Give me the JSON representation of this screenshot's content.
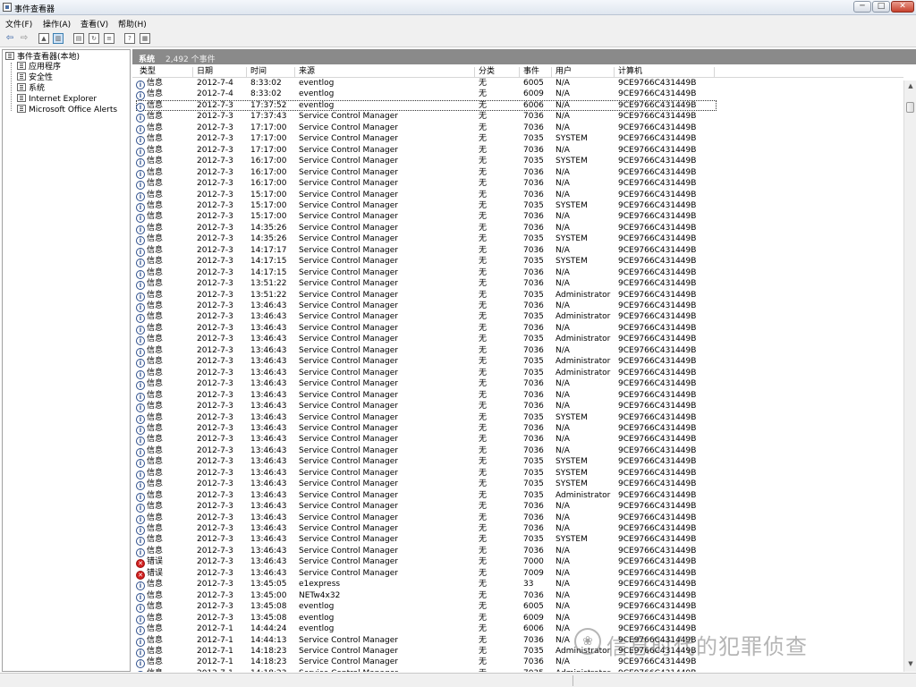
{
  "window": {
    "title": "事件查看器",
    "controls": {
      "minimize": "─",
      "maximize": "□",
      "close": "✕"
    }
  },
  "menu": [
    {
      "id": "file",
      "label": "文件(F)"
    },
    {
      "id": "action",
      "label": "操作(A)"
    },
    {
      "id": "view",
      "label": "查看(V)"
    },
    {
      "id": "help",
      "label": "帮助(H)"
    }
  ],
  "toolbar": {
    "icons": [
      "back-arrow-icon",
      "forward-arrow-icon",
      "up-folder-icon",
      "show-hide-tree-icon",
      "properties-icon",
      "refresh-icon",
      "export-list-icon",
      "help-icon",
      "console-tree-icon"
    ]
  },
  "tree": {
    "root": "事件查看器(本地)",
    "items": [
      "应用程序",
      "安全性",
      "系统",
      "Internet Explorer",
      "Microsoft Office Alerts"
    ]
  },
  "header": {
    "name": "系统",
    "count": "2,492 个事件"
  },
  "columns": {
    "type": "类型",
    "date": "日期",
    "time": "时间",
    "source": "来源",
    "category": "分类",
    "event": "事件",
    "user": "用户",
    "computer": "计算机"
  },
  "rows": [
    {
      "type": "信息",
      "kind": "info",
      "date": "2012-7-4",
      "time": "8:33:02",
      "source": "eventlog",
      "category": "无",
      "event": "6005",
      "user": "N/A",
      "computer": "9CE9766C431449B"
    },
    {
      "type": "信息",
      "kind": "info",
      "date": "2012-7-4",
      "time": "8:33:02",
      "source": "eventlog",
      "category": "无",
      "event": "6009",
      "user": "N/A",
      "computer": "9CE9766C431449B"
    },
    {
      "type": "信息",
      "kind": "info",
      "date": "2012-7-3",
      "time": "17:37:52",
      "source": "eventlog",
      "category": "无",
      "event": "6006",
      "user": "N/A",
      "computer": "9CE9766C431449B",
      "selected": true
    },
    {
      "type": "信息",
      "kind": "info",
      "date": "2012-7-3",
      "time": "17:37:43",
      "source": "Service Control Manager",
      "category": "无",
      "event": "7036",
      "user": "N/A",
      "computer": "9CE9766C431449B"
    },
    {
      "type": "信息",
      "kind": "info",
      "date": "2012-7-3",
      "time": "17:17:00",
      "source": "Service Control Manager",
      "category": "无",
      "event": "7036",
      "user": "N/A",
      "computer": "9CE9766C431449B"
    },
    {
      "type": "信息",
      "kind": "info",
      "date": "2012-7-3",
      "time": "17:17:00",
      "source": "Service Control Manager",
      "category": "无",
      "event": "7035",
      "user": "SYSTEM",
      "computer": "9CE9766C431449B"
    },
    {
      "type": "信息",
      "kind": "info",
      "date": "2012-7-3",
      "time": "17:17:00",
      "source": "Service Control Manager",
      "category": "无",
      "event": "7036",
      "user": "N/A",
      "computer": "9CE9766C431449B"
    },
    {
      "type": "信息",
      "kind": "info",
      "date": "2012-7-3",
      "time": "16:17:00",
      "source": "Service Control Manager",
      "category": "无",
      "event": "7035",
      "user": "SYSTEM",
      "computer": "9CE9766C431449B"
    },
    {
      "type": "信息",
      "kind": "info",
      "date": "2012-7-3",
      "time": "16:17:00",
      "source": "Service Control Manager",
      "category": "无",
      "event": "7036",
      "user": "N/A",
      "computer": "9CE9766C431449B"
    },
    {
      "type": "信息",
      "kind": "info",
      "date": "2012-7-3",
      "time": "16:17:00",
      "source": "Service Control Manager",
      "category": "无",
      "event": "7036",
      "user": "N/A",
      "computer": "9CE9766C431449B"
    },
    {
      "type": "信息",
      "kind": "info",
      "date": "2012-7-3",
      "time": "15:17:00",
      "source": "Service Control Manager",
      "category": "无",
      "event": "7036",
      "user": "N/A",
      "computer": "9CE9766C431449B"
    },
    {
      "type": "信息",
      "kind": "info",
      "date": "2012-7-3",
      "time": "15:17:00",
      "source": "Service Control Manager",
      "category": "无",
      "event": "7035",
      "user": "SYSTEM",
      "computer": "9CE9766C431449B"
    },
    {
      "type": "信息",
      "kind": "info",
      "date": "2012-7-3",
      "time": "15:17:00",
      "source": "Service Control Manager",
      "category": "无",
      "event": "7036",
      "user": "N/A",
      "computer": "9CE9766C431449B"
    },
    {
      "type": "信息",
      "kind": "info",
      "date": "2012-7-3",
      "time": "14:35:26",
      "source": "Service Control Manager",
      "category": "无",
      "event": "7036",
      "user": "N/A",
      "computer": "9CE9766C431449B"
    },
    {
      "type": "信息",
      "kind": "info",
      "date": "2012-7-3",
      "time": "14:35:26",
      "source": "Service Control Manager",
      "category": "无",
      "event": "7035",
      "user": "SYSTEM",
      "computer": "9CE9766C431449B"
    },
    {
      "type": "信息",
      "kind": "info",
      "date": "2012-7-3",
      "time": "14:17:17",
      "source": "Service Control Manager",
      "category": "无",
      "event": "7036",
      "user": "N/A",
      "computer": "9CE9766C431449B"
    },
    {
      "type": "信息",
      "kind": "info",
      "date": "2012-7-3",
      "time": "14:17:15",
      "source": "Service Control Manager",
      "category": "无",
      "event": "7035",
      "user": "SYSTEM",
      "computer": "9CE9766C431449B"
    },
    {
      "type": "信息",
      "kind": "info",
      "date": "2012-7-3",
      "time": "14:17:15",
      "source": "Service Control Manager",
      "category": "无",
      "event": "7036",
      "user": "N/A",
      "computer": "9CE9766C431449B"
    },
    {
      "type": "信息",
      "kind": "info",
      "date": "2012-7-3",
      "time": "13:51:22",
      "source": "Service Control Manager",
      "category": "无",
      "event": "7036",
      "user": "N/A",
      "computer": "9CE9766C431449B"
    },
    {
      "type": "信息",
      "kind": "info",
      "date": "2012-7-3",
      "time": "13:51:22",
      "source": "Service Control Manager",
      "category": "无",
      "event": "7035",
      "user": "Administrator",
      "computer": "9CE9766C431449B"
    },
    {
      "type": "信息",
      "kind": "info",
      "date": "2012-7-3",
      "time": "13:46:43",
      "source": "Service Control Manager",
      "category": "无",
      "event": "7036",
      "user": "N/A",
      "computer": "9CE9766C431449B"
    },
    {
      "type": "信息",
      "kind": "info",
      "date": "2012-7-3",
      "time": "13:46:43",
      "source": "Service Control Manager",
      "category": "无",
      "event": "7035",
      "user": "Administrator",
      "computer": "9CE9766C431449B"
    },
    {
      "type": "信息",
      "kind": "info",
      "date": "2012-7-3",
      "time": "13:46:43",
      "source": "Service Control Manager",
      "category": "无",
      "event": "7036",
      "user": "N/A",
      "computer": "9CE9766C431449B"
    },
    {
      "type": "信息",
      "kind": "info",
      "date": "2012-7-3",
      "time": "13:46:43",
      "source": "Service Control Manager",
      "category": "无",
      "event": "7035",
      "user": "Administrator",
      "computer": "9CE9766C431449B"
    },
    {
      "type": "信息",
      "kind": "info",
      "date": "2012-7-3",
      "time": "13:46:43",
      "source": "Service Control Manager",
      "category": "无",
      "event": "7036",
      "user": "N/A",
      "computer": "9CE9766C431449B"
    },
    {
      "type": "信息",
      "kind": "info",
      "date": "2012-7-3",
      "time": "13:46:43",
      "source": "Service Control Manager",
      "category": "无",
      "event": "7035",
      "user": "Administrator",
      "computer": "9CE9766C431449B"
    },
    {
      "type": "信息",
      "kind": "info",
      "date": "2012-7-3",
      "time": "13:46:43",
      "source": "Service Control Manager",
      "category": "无",
      "event": "7035",
      "user": "Administrator",
      "computer": "9CE9766C431449B"
    },
    {
      "type": "信息",
      "kind": "info",
      "date": "2012-7-3",
      "time": "13:46:43",
      "source": "Service Control Manager",
      "category": "无",
      "event": "7036",
      "user": "N/A",
      "computer": "9CE9766C431449B"
    },
    {
      "type": "信息",
      "kind": "info",
      "date": "2012-7-3",
      "time": "13:46:43",
      "source": "Service Control Manager",
      "category": "无",
      "event": "7036",
      "user": "N/A",
      "computer": "9CE9766C431449B"
    },
    {
      "type": "信息",
      "kind": "info",
      "date": "2012-7-3",
      "time": "13:46:43",
      "source": "Service Control Manager",
      "category": "无",
      "event": "7036",
      "user": "N/A",
      "computer": "9CE9766C431449B"
    },
    {
      "type": "信息",
      "kind": "info",
      "date": "2012-7-3",
      "time": "13:46:43",
      "source": "Service Control Manager",
      "category": "无",
      "event": "7035",
      "user": "SYSTEM",
      "computer": "9CE9766C431449B"
    },
    {
      "type": "信息",
      "kind": "info",
      "date": "2012-7-3",
      "time": "13:46:43",
      "source": "Service Control Manager",
      "category": "无",
      "event": "7036",
      "user": "N/A",
      "computer": "9CE9766C431449B"
    },
    {
      "type": "信息",
      "kind": "info",
      "date": "2012-7-3",
      "time": "13:46:43",
      "source": "Service Control Manager",
      "category": "无",
      "event": "7036",
      "user": "N/A",
      "computer": "9CE9766C431449B"
    },
    {
      "type": "信息",
      "kind": "info",
      "date": "2012-7-3",
      "time": "13:46:43",
      "source": "Service Control Manager",
      "category": "无",
      "event": "7036",
      "user": "N/A",
      "computer": "9CE9766C431449B"
    },
    {
      "type": "信息",
      "kind": "info",
      "date": "2012-7-3",
      "time": "13:46:43",
      "source": "Service Control Manager",
      "category": "无",
      "event": "7035",
      "user": "SYSTEM",
      "computer": "9CE9766C431449B"
    },
    {
      "type": "信息",
      "kind": "info",
      "date": "2012-7-3",
      "time": "13:46:43",
      "source": "Service Control Manager",
      "category": "无",
      "event": "7035",
      "user": "SYSTEM",
      "computer": "9CE9766C431449B"
    },
    {
      "type": "信息",
      "kind": "info",
      "date": "2012-7-3",
      "time": "13:46:43",
      "source": "Service Control Manager",
      "category": "无",
      "event": "7035",
      "user": "SYSTEM",
      "computer": "9CE9766C431449B"
    },
    {
      "type": "信息",
      "kind": "info",
      "date": "2012-7-3",
      "time": "13:46:43",
      "source": "Service Control Manager",
      "category": "无",
      "event": "7035",
      "user": "Administrator",
      "computer": "9CE9766C431449B"
    },
    {
      "type": "信息",
      "kind": "info",
      "date": "2012-7-3",
      "time": "13:46:43",
      "source": "Service Control Manager",
      "category": "无",
      "event": "7036",
      "user": "N/A",
      "computer": "9CE9766C431449B"
    },
    {
      "type": "信息",
      "kind": "info",
      "date": "2012-7-3",
      "time": "13:46:43",
      "source": "Service Control Manager",
      "category": "无",
      "event": "7036",
      "user": "N/A",
      "computer": "9CE9766C431449B"
    },
    {
      "type": "信息",
      "kind": "info",
      "date": "2012-7-3",
      "time": "13:46:43",
      "source": "Service Control Manager",
      "category": "无",
      "event": "7036",
      "user": "N/A",
      "computer": "9CE9766C431449B"
    },
    {
      "type": "信息",
      "kind": "info",
      "date": "2012-7-3",
      "time": "13:46:43",
      "source": "Service Control Manager",
      "category": "无",
      "event": "7035",
      "user": "SYSTEM",
      "computer": "9CE9766C431449B"
    },
    {
      "type": "信息",
      "kind": "info",
      "date": "2012-7-3",
      "time": "13:46:43",
      "source": "Service Control Manager",
      "category": "无",
      "event": "7036",
      "user": "N/A",
      "computer": "9CE9766C431449B"
    },
    {
      "type": "错误",
      "kind": "error",
      "date": "2012-7-3",
      "time": "13:46:43",
      "source": "Service Control Manager",
      "category": "无",
      "event": "7000",
      "user": "N/A",
      "computer": "9CE9766C431449B"
    },
    {
      "type": "错误",
      "kind": "error",
      "date": "2012-7-3",
      "time": "13:46:43",
      "source": "Service Control Manager",
      "category": "无",
      "event": "7009",
      "user": "N/A",
      "computer": "9CE9766C431449B"
    },
    {
      "type": "信息",
      "kind": "info",
      "date": "2012-7-3",
      "time": "13:45:05",
      "source": "e1express",
      "category": "无",
      "event": "33",
      "user": "N/A",
      "computer": "9CE9766C431449B"
    },
    {
      "type": "信息",
      "kind": "info",
      "date": "2012-7-3",
      "time": "13:45:00",
      "source": "NETw4x32",
      "category": "无",
      "event": "7036",
      "user": "N/A",
      "computer": "9CE9766C431449B"
    },
    {
      "type": "信息",
      "kind": "info",
      "date": "2012-7-3",
      "time": "13:45:08",
      "source": "eventlog",
      "category": "无",
      "event": "6005",
      "user": "N/A",
      "computer": "9CE9766C431449B"
    },
    {
      "type": "信息",
      "kind": "info",
      "date": "2012-7-3",
      "time": "13:45:08",
      "source": "eventlog",
      "category": "无",
      "event": "6009",
      "user": "N/A",
      "computer": "9CE9766C431449B"
    },
    {
      "type": "信息",
      "kind": "info",
      "date": "2012-7-1",
      "time": "14:44:24",
      "source": "eventlog",
      "category": "无",
      "event": "6006",
      "user": "N/A",
      "computer": "9CE9766C431449B"
    },
    {
      "type": "信息",
      "kind": "info",
      "date": "2012-7-1",
      "time": "14:44:13",
      "source": "Service Control Manager",
      "category": "无",
      "event": "7036",
      "user": "N/A",
      "computer": "9CE9766C431449B"
    },
    {
      "type": "信息",
      "kind": "info",
      "date": "2012-7-1",
      "time": "14:18:23",
      "source": "Service Control Manager",
      "category": "无",
      "event": "7035",
      "user": "Administrator",
      "computer": "9CE9766C431449B"
    },
    {
      "type": "信息",
      "kind": "info",
      "date": "2012-7-1",
      "time": "14:18:23",
      "source": "Service Control Manager",
      "category": "无",
      "event": "7036",
      "user": "N/A",
      "computer": "9CE9766C431449B"
    },
    {
      "type": "信息",
      "kind": "info",
      "date": "2012-7-1",
      "time": "14:18:23",
      "source": "Service Control Manager",
      "category": "无",
      "event": "7035",
      "user": "Administrator",
      "computer": "9CE9766C431449B"
    }
  ],
  "watermark": {
    "logo": "❀",
    "text": "信息时代的犯罪侦查"
  },
  "colors": {
    "header_bg": "#8a8a8a",
    "info_icon": "#2e4f8c",
    "error_icon": "#d2201f"
  }
}
